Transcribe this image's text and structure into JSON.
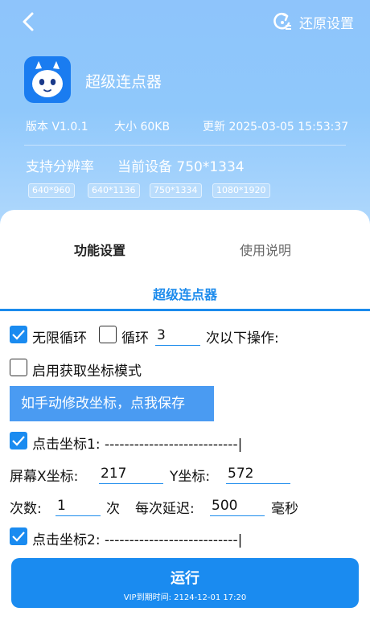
{
  "header": {
    "restore_label": "还原设置"
  },
  "app": {
    "name": "超级连点器",
    "version": "版本  V1.0.1",
    "size": "大小 60KB",
    "updated": "更新 2025-03-05 15:53:37",
    "resolution_label": "支持分辨率",
    "current_device": "当前设备 750*1334",
    "resolutions": [
      "640*960",
      "640*1136",
      "750*1334",
      "1080*1920"
    ]
  },
  "tabs": [
    {
      "label": "功能设置",
      "active": true
    },
    {
      "label": "使用说明",
      "active": false
    }
  ],
  "section_title": "超级连点器",
  "loop": {
    "infinite_label": "无限循环",
    "infinite_checked": true,
    "loop_label": "循环",
    "loop_checked": false,
    "loop_count": "3",
    "suffix": "次以下操作:"
  },
  "coord_mode": {
    "label": "启用获取坐标模式",
    "checked": false
  },
  "save_button": "如手动修改坐标，点我保存",
  "click1": {
    "label": "点击坐标1:  ---------------------------|",
    "checked": true,
    "x_label": "屏幕X坐标:",
    "x_value": "217",
    "y_label": "Y坐标:",
    "y_value": "572",
    "count_label": "次数:",
    "count_value": "1",
    "count_unit": "次",
    "delay_label": "每次延迟:",
    "delay_value": "500",
    "delay_unit": "毫秒"
  },
  "click2": {
    "label": "点击坐标2:  ---------------------------|",
    "checked": true
  },
  "run": {
    "label": "运行",
    "vip": "VIP到期时间:  2124-12-01 17:20"
  },
  "colors": {
    "accent": "#1a8bf0",
    "hero_top": "#8ec4fb",
    "save_button": "#4a9bf2"
  }
}
